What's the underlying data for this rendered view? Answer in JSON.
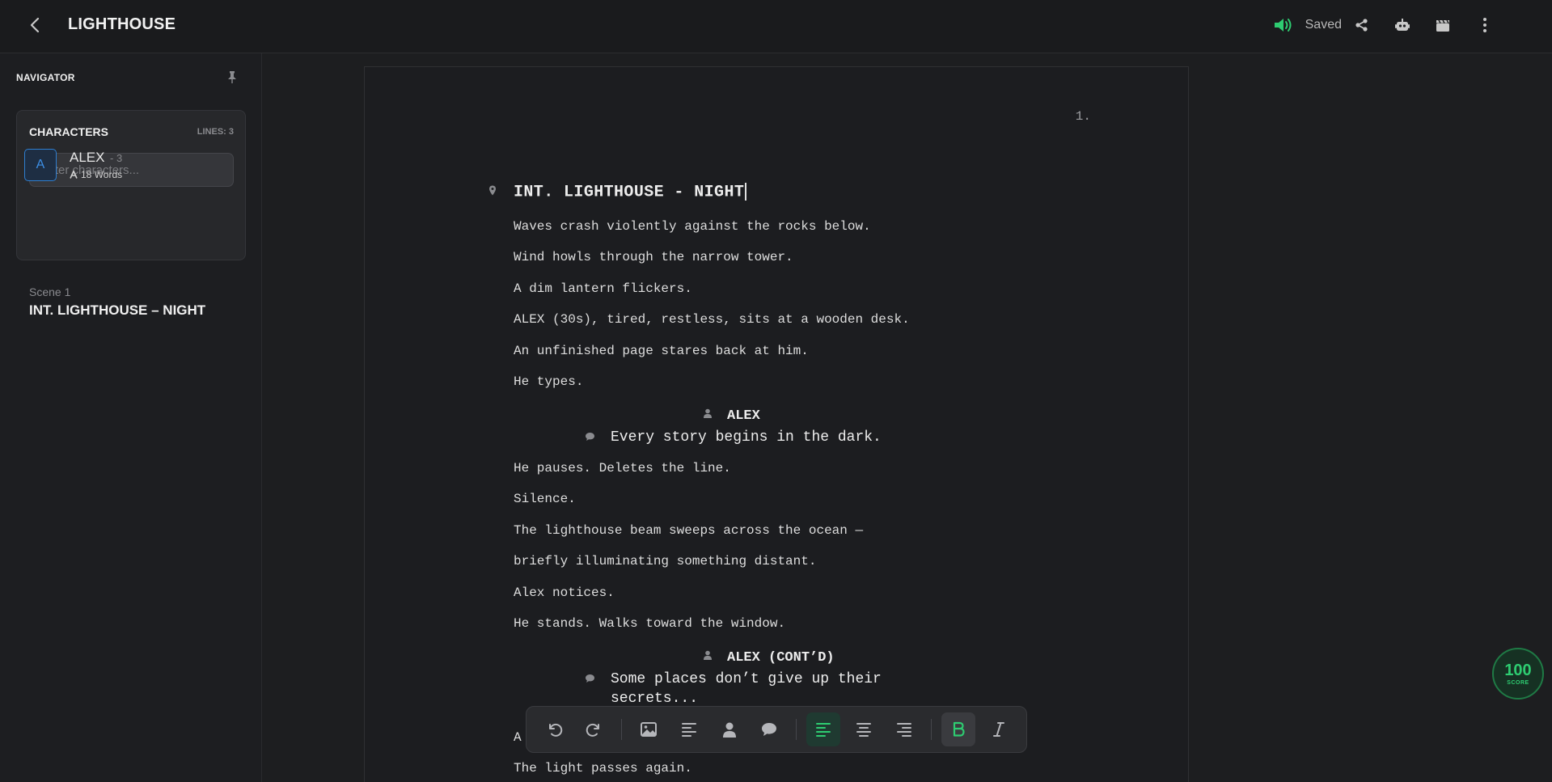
{
  "header": {
    "title": "LIGHTHOUSE",
    "saved_label": "Saved",
    "icons": [
      "back-icon",
      "speaker-icon",
      "share-icon",
      "robot-icon",
      "clapperboard-icon",
      "more-vertical-icon"
    ]
  },
  "sidebar": {
    "navigator_title": "NAVIGATOR",
    "characters": {
      "title": "CHARACTERS",
      "lines_label": "LINES: 3",
      "filter_placeholder": "Filter characters...",
      "items": [
        {
          "initial": "A",
          "name": "ALEX",
          "count": "- 3",
          "words": "18 Words"
        }
      ]
    },
    "scenes": [
      {
        "label": "Scene 1",
        "heading": "INT. LIGHTHOUSE – NIGHT"
      }
    ]
  },
  "script": {
    "page_number": "1.",
    "scene_heading": "INT. LIGHTHOUSE - NIGHT",
    "actions_1": [
      "Waves crash violently against the rocks below.",
      "Wind howls through the narrow tower.",
      "A dim lantern flickers.",
      "ALEX (30s), tired, restless, sits at a wooden desk.",
      "An unfinished page stares back at him.",
      "He types."
    ],
    "cue_1": "ALEX",
    "dialogue_1": "Every story begins in the dark.",
    "actions_2": [
      "He pauses. Deletes the line.",
      "Silence.",
      "The lighthouse beam sweeps across the ocean —",
      "briefly illuminating something distant.",
      "Alex notices.",
      "He stands. Walks toward the window."
    ],
    "cue_2": "ALEX (CONT’D)",
    "dialogue_2": "Some places don’t give up their secrets...",
    "actions_3": [
      "A",
      "The light passes again."
    ]
  },
  "toolbar": {
    "buttons": [
      "undo",
      "redo",
      "image",
      "action",
      "character",
      "dialogue",
      "align-left",
      "align-center",
      "align-right",
      "bold",
      "italic"
    ],
    "active": [
      "align-left",
      "bold"
    ]
  },
  "score": {
    "value": "100",
    "label": "SCORE"
  },
  "colors": {
    "accent": "#2ecc71",
    "avatar": "#2f7fd1",
    "background": "#1d1e20"
  }
}
